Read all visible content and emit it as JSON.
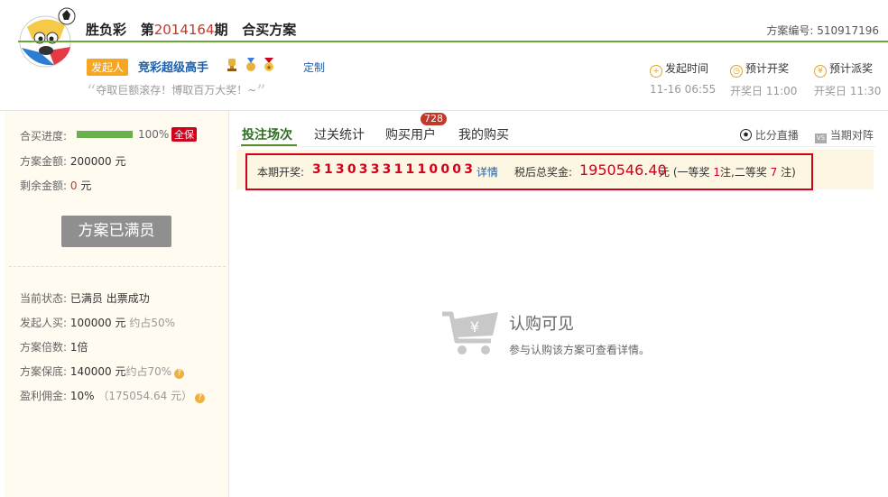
{
  "header": {
    "lottery": "胜负彩",
    "issue_prefix": "第",
    "issue_no": "2014164",
    "issue_suffix": "期",
    "page": "合买方案",
    "plan_no_label": "方案编号:",
    "plan_no": "510917196"
  },
  "initiator": {
    "tag": "发起人",
    "name": "竞彩超级高手",
    "customize": "定制",
    "slogan": "夺取巨额滚存！博取百万大奖！~"
  },
  "times": [
    {
      "label": "发起时间",
      "value": "11-16 06:55",
      "icon": "plus-circle-icon"
    },
    {
      "label": "预计开奖",
      "value": "开奖日 11:00",
      "icon": "clock-icon"
    },
    {
      "label": "预计派奖",
      "value": "开奖日 11:30",
      "icon": "yen-icon"
    }
  ],
  "left": {
    "progress_label": "合买进度:",
    "progress_value": "100%",
    "progress_fraction": 1.0,
    "full_badge": "全保",
    "amount_label": "方案金额:",
    "amount_value": "200000",
    "amount_unit": "元",
    "remain_label": "剩余金额:",
    "remain_value": "0",
    "remain_unit": "元",
    "full_button": "方案已满员",
    "status_label": "当前状态:",
    "status_value": "已满员 出票成功",
    "buy_label": "发起人买:",
    "buy_value": "100000 元",
    "buy_ratio": "约占50%",
    "multiple_label": "方案倍数:",
    "multiple_value": "1倍",
    "guarantee_label": "方案保底:",
    "guarantee_value": "140000 元",
    "guarantee_ratio": "约占70%",
    "commission_label": "盈利佣金:",
    "commission_value": "10%",
    "commission_amount": "（175054.64 元）"
  },
  "tabs": {
    "bet": "投注场次",
    "stats": "过关统计",
    "buyers": "购买用户",
    "buyers_count": "728",
    "mine": "我的购买",
    "live": "比分直播",
    "lineup": "当期对阵"
  },
  "draw": {
    "label": "本期开奖:",
    "numbers": "31303331110003",
    "detail": "详情",
    "prize_label": "税后总奖金:",
    "prize_amount": "1950546.40",
    "prize_unit": "元",
    "prize_open": "(一等奖",
    "first_count": "1",
    "prize_mid": "注,二等奖",
    "second_count": "7",
    "prize_close": "注)"
  },
  "subscribe": {
    "title": "认购可见",
    "desc": "参与认购该方案可查看详情。"
  },
  "colors": {
    "accent_green": "#6ba83a",
    "red": "#d0021b",
    "link_blue": "#1f5fa8",
    "orange": "#f5a623"
  }
}
